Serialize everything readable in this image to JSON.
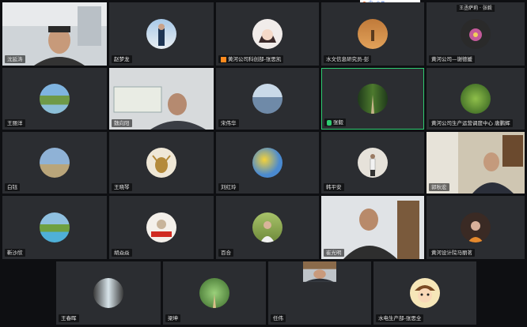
{
  "window": {
    "top_toolbar_label": "中 · ⊕ ▦"
  },
  "participants": [
    {
      "name": "沈延涛",
      "kind": "video",
      "active": false
    },
    {
      "name": "赵梦龙",
      "kind": "avatar",
      "icon": "person-outdoor-avatar"
    },
    {
      "name": "黄河公司科创部-张思凯",
      "kind": "avatar",
      "icon": "anime-avatar",
      "cam_off_badge": true
    },
    {
      "name": "水文信息研究员-彭",
      "kind": "avatar",
      "icon": "desert-avatar"
    },
    {
      "name": "黄河公司—谢德媛",
      "kind": "avatar",
      "icon": "flower-avatar",
      "top_name": "王丞萨莉 · 张毅"
    },
    {
      "name": "王丽洋",
      "kind": "avatar",
      "icon": "river-avatar"
    },
    {
      "name": "魏向阳",
      "kind": "video"
    },
    {
      "name": "宋伟华",
      "kind": "avatar",
      "icon": "lake-avatar"
    },
    {
      "name": "张毅",
      "kind": "avatar",
      "icon": "forest-path-avatar",
      "active": true
    },
    {
      "name": "黄河公司生产运营调度中心 唐鹏辉",
      "kind": "avatar",
      "icon": "leaves-avatar"
    },
    {
      "name": "白钰",
      "kind": "avatar",
      "icon": "sky-avatar"
    },
    {
      "name": "王晓琴",
      "kind": "avatar",
      "icon": "bull-avatar"
    },
    {
      "name": "刘红玲",
      "kind": "avatar",
      "icon": "flowers-avatar"
    },
    {
      "name": "韩平安",
      "kind": "avatar",
      "icon": "standing-person-avatar"
    },
    {
      "name": "郭秋宏",
      "kind": "video"
    },
    {
      "name": "靳沙欣",
      "kind": "avatar",
      "icon": "river-bend-avatar"
    },
    {
      "name": "胡焱焱",
      "kind": "avatar",
      "icon": "badge-avatar"
    },
    {
      "name": "百合",
      "kind": "avatar",
      "icon": "woman-outdoor-avatar"
    },
    {
      "name": "崔光明",
      "kind": "video"
    },
    {
      "name": "黄河设计院马丽茗",
      "kind": "avatar",
      "icon": "woman-portrait-avatar"
    },
    {
      "name": "王春晖",
      "kind": "avatar",
      "icon": "waterfall-avatar"
    },
    {
      "name": "梁坤",
      "kind": "avatar",
      "icon": "garden-avatar"
    },
    {
      "name": "任伟",
      "kind": "video"
    },
    {
      "name": "水电生产部-张思全",
      "kind": "avatar",
      "icon": "cartoon-face-avatar"
    }
  ],
  "colors": {
    "tile_bg": "#2b2d31",
    "active_border": "#2ecc71",
    "background": "#0e0f12"
  }
}
